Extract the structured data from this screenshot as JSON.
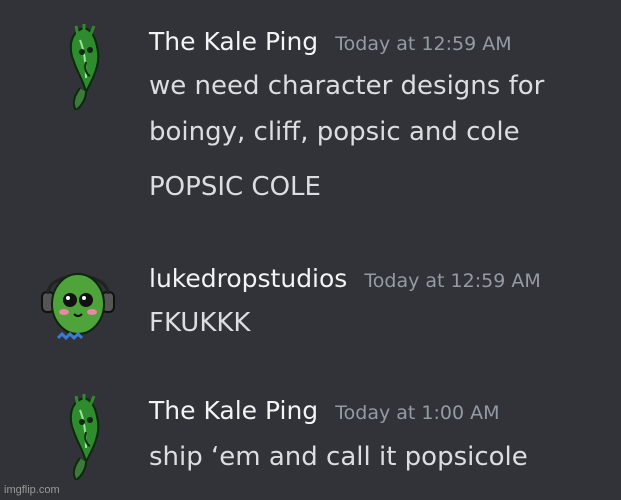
{
  "colors": {
    "background": "#313338",
    "author": "#f2f3f5",
    "text": "#dbdee1",
    "timestamp": "#949ba4"
  },
  "messages": [
    {
      "author": "The Kale Ping",
      "timestamp": "Today at 12:59 AM",
      "avatar_icon": "kale-leaf-avatar-icon",
      "lines": [
        "we need character designs for",
        "boingy, cliff, popsic and cole",
        "POPSIC COLE"
      ]
    },
    {
      "author": "lukedropstudios",
      "timestamp": "Today at 12:59 AM",
      "avatar_icon": "green-bean-headphones-avatar-icon",
      "lines": [
        "FKUKKK"
      ]
    },
    {
      "author": "The Kale Ping",
      "timestamp": "Today at 1:00 AM",
      "avatar_icon": "kale-leaf-avatar-icon",
      "lines": [
        "ship ‘em and call it popsicole"
      ]
    }
  ],
  "watermark": "imgflip.com"
}
